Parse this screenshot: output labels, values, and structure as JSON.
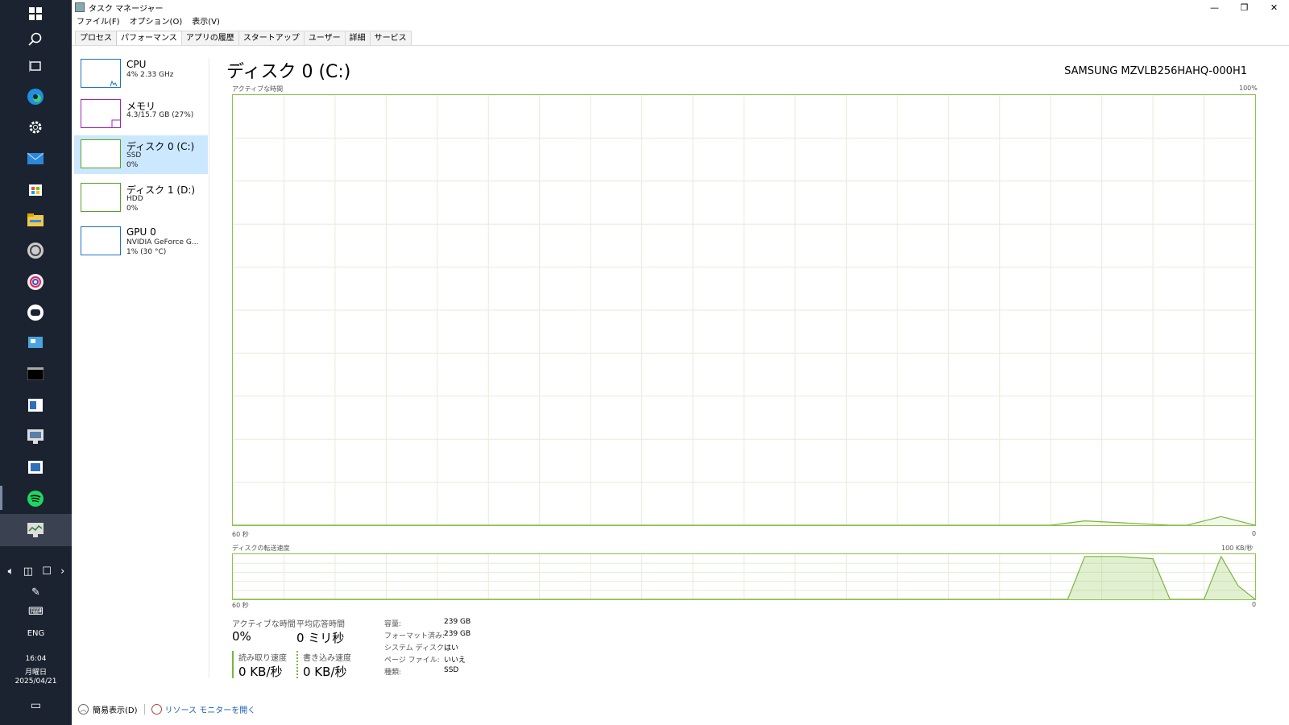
{
  "taskbar": {
    "icons": [
      "windows-start-icon",
      "search-icon",
      "task-view-icon",
      "edge-icon",
      "settings-icon",
      "mail-icon",
      "store-icon",
      "file-explorer-icon",
      "app-icon",
      "app-icon",
      "line-icon",
      "app-icon",
      "terminal-icon",
      "app-icon",
      "app-icon",
      "app-icon",
      "spotify-icon",
      "task-manager-icon"
    ],
    "language": "ENG",
    "time": "16:04",
    "weekday": "月曜日",
    "date": "2025/04/21"
  },
  "window": {
    "title": "タスク マネージャー",
    "menu": [
      "ファイル(F)",
      "オプション(O)",
      "表示(V)"
    ],
    "tabs": [
      "プロセス",
      "パフォーマンス",
      "アプリの履歴",
      "スタートアップ",
      "ユーザー",
      "詳細",
      "サービス"
    ],
    "selected_tab": "パフォーマンス"
  },
  "devices": [
    {
      "name": "CPU",
      "lines": [
        "4%  2.33 GHz"
      ],
      "color": "#1a73c7"
    },
    {
      "name": "メモリ",
      "lines": [
        "4.3/15.7 GB (27%)"
      ],
      "color": "#9c27b0"
    },
    {
      "name": "ディスク 0 (C:)",
      "lines": [
        "SSD",
        "0%"
      ],
      "color": "#5aa02c"
    },
    {
      "name": "ディスク 1 (D:)",
      "lines": [
        "HDD",
        "0%"
      ],
      "color": "#5aa02c"
    },
    {
      "name": "GPU 0",
      "lines": [
        "NVIDIA GeForce G...",
        "1% (30 °C)"
      ],
      "color": "#1a73c7"
    }
  ],
  "main": {
    "title": "ディスク 0 (C:)",
    "model": "SAMSUNG MZVLB256HAHQ-000H1",
    "graph1": {
      "label": "アクティブな時間",
      "max": "100%",
      "time_left": "60 秒",
      "time_right": "0"
    },
    "graph2": {
      "label": "ディスクの転送速度",
      "max": "100 KB/秒",
      "time_left": "60 秒",
      "time_right": "0"
    },
    "stats": {
      "active_time_label": "アクティブな時間",
      "active_time": "0%",
      "avg_response_label": "平均応答時間",
      "avg_response": "0 ミリ秒",
      "read_label": "読み取り速度",
      "read": "0 KB/秒",
      "write_label": "書き込み速度",
      "write": "0 KB/秒"
    },
    "info": [
      {
        "label": "容量:",
        "value": "239 GB"
      },
      {
        "label": "フォーマット済み:",
        "value": "239 GB"
      },
      {
        "label": "システム ディスク:",
        "value": "はい"
      },
      {
        "label": "ページ ファイル:",
        "value": "いいえ"
      },
      {
        "label": "種類:",
        "value": "SSD"
      }
    ]
  },
  "footer": {
    "fewer_details": "簡易表示(D)",
    "resource_monitor": "リソース モニターを開く"
  },
  "chart_data": [
    {
      "type": "line",
      "title": "アクティブな時間",
      "xlabel": "",
      "ylabel": "",
      "x_range": [
        60,
        0
      ],
      "ylim": [
        0,
        100
      ],
      "x": [
        60,
        12,
        10,
        5,
        4,
        2,
        0
      ],
      "values": [
        0,
        0,
        1,
        0,
        0,
        2,
        0
      ]
    },
    {
      "type": "area",
      "title": "ディスクの転送速度",
      "ylim": [
        0,
        100
      ],
      "x_range": [
        60,
        0
      ],
      "series": [
        {
          "x": [
            60,
            11,
            10,
            8,
            6,
            5,
            3,
            2,
            1,
            0
          ],
          "values": [
            0,
            0,
            95,
            95,
            90,
            0,
            0,
            95,
            30,
            0
          ]
        }
      ]
    }
  ]
}
